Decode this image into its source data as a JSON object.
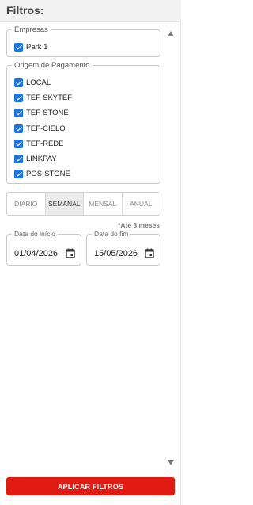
{
  "header": {
    "title": "Filtros:"
  },
  "empresas": {
    "legend": "Empresas",
    "items": [
      {
        "label": "Park 1",
        "checked": true
      }
    ]
  },
  "origem": {
    "legend": "Origem de Pagamento",
    "items": [
      {
        "label": "LOCAL",
        "checked": true
      },
      {
        "label": "TEF-SKYTEF",
        "checked": true
      },
      {
        "label": "TEF-STONE",
        "checked": true
      },
      {
        "label": "TEF-CIELO",
        "checked": true
      },
      {
        "label": "TEF-REDE",
        "checked": true
      },
      {
        "label": "LINKPAY",
        "checked": true
      },
      {
        "label": "POS-STONE",
        "checked": true
      }
    ]
  },
  "period": {
    "options": [
      "DIÁRIO",
      "SEMANAL",
      "MENSAL",
      "ANUAL"
    ],
    "selected": "SEMANAL"
  },
  "note": "*Até 3 meses",
  "dates": {
    "start": {
      "label": "Data do início",
      "value": "01/04/2026"
    },
    "end": {
      "label": "Data do fim",
      "value": "15/05/2026"
    }
  },
  "apply": {
    "label": "APLICAR FILTROS"
  },
  "colors": {
    "accent": "#e21b12",
    "checkbox": "#1a73e8",
    "header_bg": "#f2f2f2"
  },
  "icons": {
    "scroll_up": "triangle-up-icon",
    "scroll_down": "triangle-down-icon",
    "date": "calendar-icon"
  }
}
